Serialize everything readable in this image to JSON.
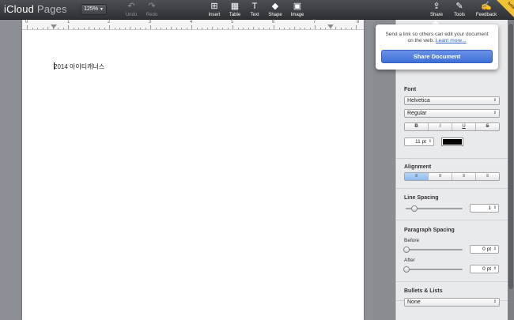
{
  "app": {
    "brand_main": "iCloud",
    "brand_sub": "Pages"
  },
  "toolbar": {
    "zoom": "125%",
    "undo": "Undo",
    "redo": "Redo",
    "insert": "Insert",
    "table": "Table",
    "text": "Text",
    "shape": "Shape",
    "image": "Image",
    "share": "Share",
    "tools": "Tools",
    "feedback": "Feedback",
    "beta": "beta"
  },
  "ruler": {
    "numbers": [
      "0",
      "1",
      "2",
      "3",
      "4",
      "5",
      "6",
      "7",
      "8"
    ]
  },
  "document": {
    "text": "2014 아이티캐너스"
  },
  "share_popover": {
    "message": "Send a link so others can edit your document on the web.",
    "learn_more": "Learn more...",
    "button": "Share Document"
  },
  "sidebar": {
    "font": {
      "title": "Font",
      "family": "Helvetica",
      "style": "Regular",
      "format": [
        "B",
        "I",
        "U",
        "S"
      ],
      "size": "11 pt"
    },
    "alignment": {
      "title": "Alignment",
      "options": [
        "≡",
        "≡",
        "≡",
        "≡"
      ]
    },
    "line_spacing": {
      "title": "Line Spacing",
      "value": "1"
    },
    "paragraph_spacing": {
      "title": "Paragraph Spacing",
      "before_label": "Before",
      "before": "0 pt",
      "after_label": "After",
      "after": "0 pt"
    },
    "bullets": {
      "title": "Bullets & Lists",
      "value": "None"
    }
  },
  "colors": {
    "accent": "#3f6fd6",
    "toolbar": "#3a3d42",
    "text_color": "#000000"
  }
}
